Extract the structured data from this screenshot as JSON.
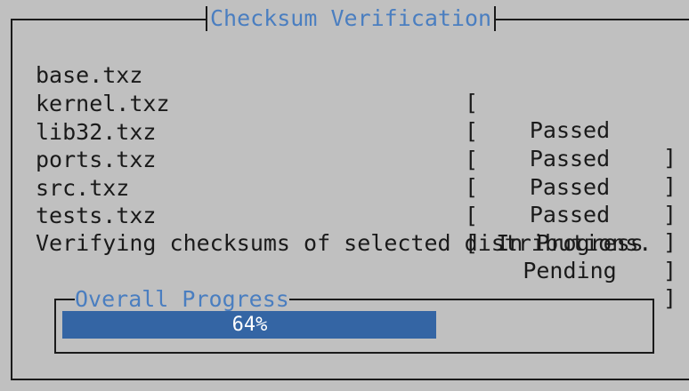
{
  "dialog": {
    "title": "Checksum Verification",
    "message": "Verifying checksums of selected distributions."
  },
  "files": [
    {
      "name": "base.txz",
      "status": "Passed"
    },
    {
      "name": "kernel.txz",
      "status": "Passed"
    },
    {
      "name": "lib32.txz",
      "status": "Passed"
    },
    {
      "name": "ports.txz",
      "status": "Passed"
    },
    {
      "name": "src.txz",
      "status": "In Progress"
    },
    {
      "name": "tests.txz",
      "status": "Pending"
    }
  ],
  "brackets": {
    "open": "[",
    "close": "]"
  },
  "progress": {
    "label": "Overall Progress",
    "percent_text": "64%",
    "value": 0.64
  },
  "colors": {
    "background": "#3465a4",
    "dialog": "#c0c0c0",
    "accent_text": "#4a7ec0",
    "bar_fill": "#3465a4",
    "text": "#1a1a1a"
  }
}
